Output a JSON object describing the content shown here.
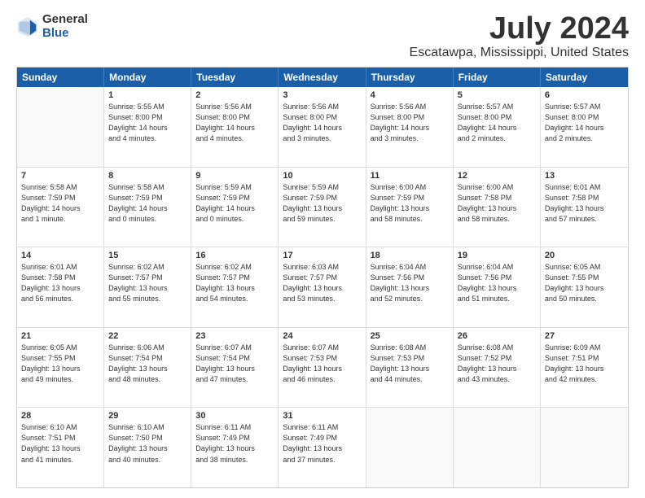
{
  "logo": {
    "general": "General",
    "blue": "Blue"
  },
  "title": "July 2024",
  "subtitle": "Escatawpa, Mississippi, United States",
  "headers": [
    "Sunday",
    "Monday",
    "Tuesday",
    "Wednesday",
    "Thursday",
    "Friday",
    "Saturday"
  ],
  "rows": [
    [
      {
        "day": "",
        "text": "",
        "empty": true
      },
      {
        "day": "1",
        "text": "Sunrise: 5:55 AM\nSunset: 8:00 PM\nDaylight: 14 hours\nand 4 minutes."
      },
      {
        "day": "2",
        "text": "Sunrise: 5:56 AM\nSunset: 8:00 PM\nDaylight: 14 hours\nand 4 minutes."
      },
      {
        "day": "3",
        "text": "Sunrise: 5:56 AM\nSunset: 8:00 PM\nDaylight: 14 hours\nand 3 minutes."
      },
      {
        "day": "4",
        "text": "Sunrise: 5:56 AM\nSunset: 8:00 PM\nDaylight: 14 hours\nand 3 minutes."
      },
      {
        "day": "5",
        "text": "Sunrise: 5:57 AM\nSunset: 8:00 PM\nDaylight: 14 hours\nand 2 minutes."
      },
      {
        "day": "6",
        "text": "Sunrise: 5:57 AM\nSunset: 8:00 PM\nDaylight: 14 hours\nand 2 minutes."
      }
    ],
    [
      {
        "day": "7",
        "text": "Sunrise: 5:58 AM\nSunset: 7:59 PM\nDaylight: 14 hours\nand 1 minute."
      },
      {
        "day": "8",
        "text": "Sunrise: 5:58 AM\nSunset: 7:59 PM\nDaylight: 14 hours\nand 0 minutes."
      },
      {
        "day": "9",
        "text": "Sunrise: 5:59 AM\nSunset: 7:59 PM\nDaylight: 14 hours\nand 0 minutes."
      },
      {
        "day": "10",
        "text": "Sunrise: 5:59 AM\nSunset: 7:59 PM\nDaylight: 13 hours\nand 59 minutes."
      },
      {
        "day": "11",
        "text": "Sunrise: 6:00 AM\nSunset: 7:59 PM\nDaylight: 13 hours\nand 58 minutes."
      },
      {
        "day": "12",
        "text": "Sunrise: 6:00 AM\nSunset: 7:58 PM\nDaylight: 13 hours\nand 58 minutes."
      },
      {
        "day": "13",
        "text": "Sunrise: 6:01 AM\nSunset: 7:58 PM\nDaylight: 13 hours\nand 57 minutes."
      }
    ],
    [
      {
        "day": "14",
        "text": "Sunrise: 6:01 AM\nSunset: 7:58 PM\nDaylight: 13 hours\nand 56 minutes."
      },
      {
        "day": "15",
        "text": "Sunrise: 6:02 AM\nSunset: 7:57 PM\nDaylight: 13 hours\nand 55 minutes."
      },
      {
        "day": "16",
        "text": "Sunrise: 6:02 AM\nSunset: 7:57 PM\nDaylight: 13 hours\nand 54 minutes."
      },
      {
        "day": "17",
        "text": "Sunrise: 6:03 AM\nSunset: 7:57 PM\nDaylight: 13 hours\nand 53 minutes."
      },
      {
        "day": "18",
        "text": "Sunrise: 6:04 AM\nSunset: 7:56 PM\nDaylight: 13 hours\nand 52 minutes."
      },
      {
        "day": "19",
        "text": "Sunrise: 6:04 AM\nSunset: 7:56 PM\nDaylight: 13 hours\nand 51 minutes."
      },
      {
        "day": "20",
        "text": "Sunrise: 6:05 AM\nSunset: 7:55 PM\nDaylight: 13 hours\nand 50 minutes."
      }
    ],
    [
      {
        "day": "21",
        "text": "Sunrise: 6:05 AM\nSunset: 7:55 PM\nDaylight: 13 hours\nand 49 minutes."
      },
      {
        "day": "22",
        "text": "Sunrise: 6:06 AM\nSunset: 7:54 PM\nDaylight: 13 hours\nand 48 minutes."
      },
      {
        "day": "23",
        "text": "Sunrise: 6:07 AM\nSunset: 7:54 PM\nDaylight: 13 hours\nand 47 minutes."
      },
      {
        "day": "24",
        "text": "Sunrise: 6:07 AM\nSunset: 7:53 PM\nDaylight: 13 hours\nand 46 minutes."
      },
      {
        "day": "25",
        "text": "Sunrise: 6:08 AM\nSunset: 7:53 PM\nDaylight: 13 hours\nand 44 minutes."
      },
      {
        "day": "26",
        "text": "Sunrise: 6:08 AM\nSunset: 7:52 PM\nDaylight: 13 hours\nand 43 minutes."
      },
      {
        "day": "27",
        "text": "Sunrise: 6:09 AM\nSunset: 7:51 PM\nDaylight: 13 hours\nand 42 minutes."
      }
    ],
    [
      {
        "day": "28",
        "text": "Sunrise: 6:10 AM\nSunset: 7:51 PM\nDaylight: 13 hours\nand 41 minutes."
      },
      {
        "day": "29",
        "text": "Sunrise: 6:10 AM\nSunset: 7:50 PM\nDaylight: 13 hours\nand 40 minutes."
      },
      {
        "day": "30",
        "text": "Sunrise: 6:11 AM\nSunset: 7:49 PM\nDaylight: 13 hours\nand 38 minutes."
      },
      {
        "day": "31",
        "text": "Sunrise: 6:11 AM\nSunset: 7:49 PM\nDaylight: 13 hours\nand 37 minutes."
      },
      {
        "day": "",
        "text": "",
        "empty": true
      },
      {
        "day": "",
        "text": "",
        "empty": true
      },
      {
        "day": "",
        "text": "",
        "empty": true
      }
    ]
  ]
}
